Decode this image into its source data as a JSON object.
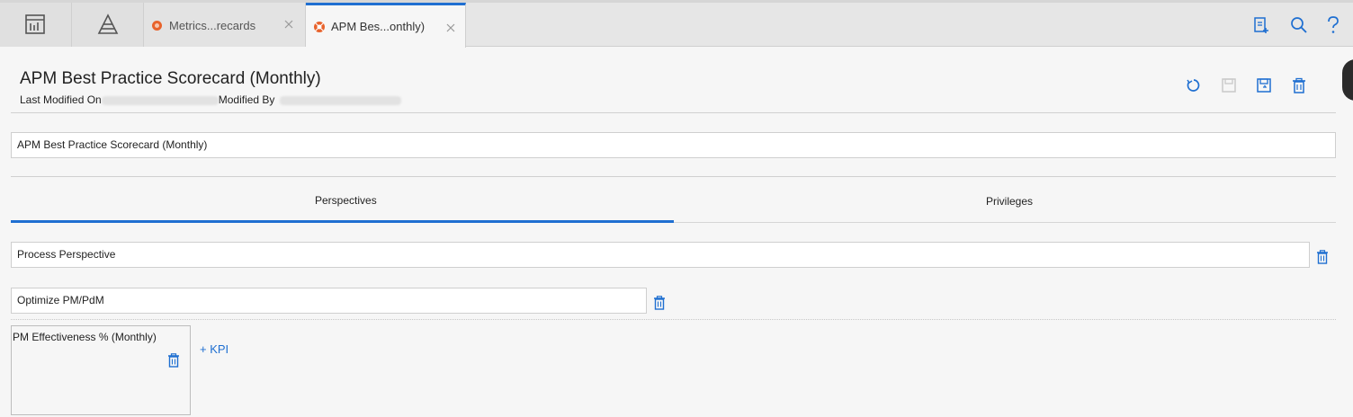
{
  "topbar": {
    "tabs": [
      {
        "label": "Metrics...recards",
        "active": false
      },
      {
        "label": "APM Bes...onthly)",
        "active": true
      }
    ],
    "right_icons": [
      "new-document-icon",
      "search-icon",
      "help-icon"
    ],
    "colors": {
      "accent": "#1f6fd1",
      "tab_icon": "#e8632c"
    }
  },
  "header": {
    "title": "APM Best Practice Scorecard (Monthly)",
    "last_modified_label": "Last Modified On",
    "modified_by_label": "Modified By",
    "actions": [
      "refresh-icon",
      "save-icon",
      "save-as-icon",
      "delete-icon"
    ]
  },
  "name_field": {
    "value": "APM Best Practice Scorecard (Monthly)"
  },
  "tabs": {
    "perspectives": "Perspectives",
    "privileges": "Privileges",
    "active": "perspectives"
  },
  "perspective": {
    "name": "Process Perspective",
    "objective": {
      "name": "Optimize PM/PdM",
      "kpis": [
        {
          "name": "PM Effectiveness % (Monthly)"
        }
      ],
      "add_kpi_label": "+ KPI"
    }
  }
}
